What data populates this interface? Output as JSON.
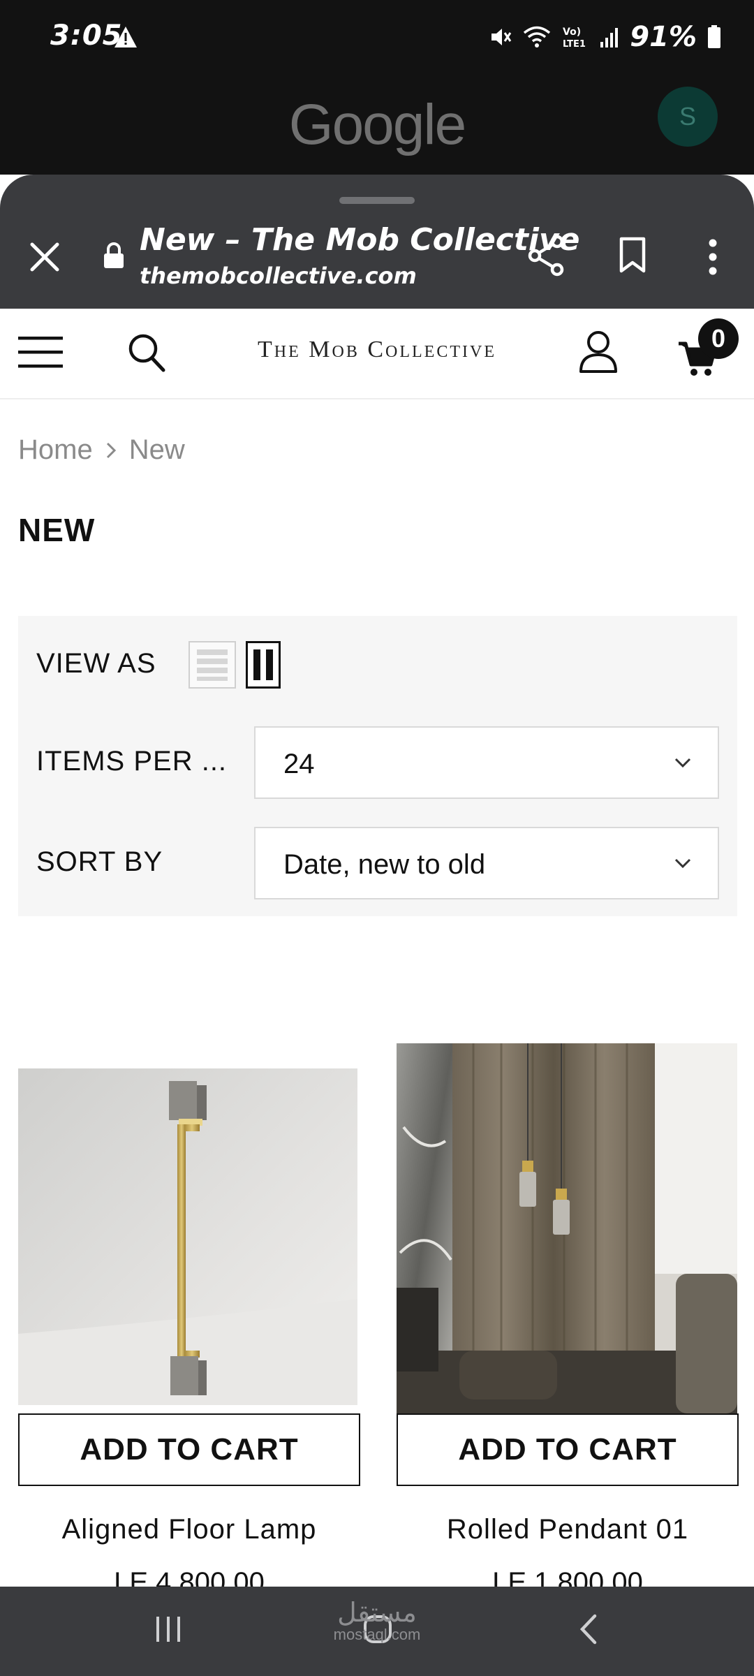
{
  "status_bar": {
    "time": "3:05",
    "battery": "91%",
    "network": "Vo) LTE1"
  },
  "google": {
    "logo": "Google",
    "avatar_letter": "S"
  },
  "custom_tab": {
    "title": "New – The Mob Collective",
    "url": "themobcollective.com"
  },
  "header": {
    "brand": "The Mob Collective",
    "cart_count": "0"
  },
  "breadcrumb": {
    "home": "Home",
    "current": "New"
  },
  "page": {
    "title": "NEW"
  },
  "toolbar": {
    "view_as_label": "VIEW AS",
    "items_per_label": "ITEMS PER ...",
    "items_per_value": "24",
    "sort_by_label": "SORT BY",
    "sort_by_value": "Date, new to old"
  },
  "products": [
    {
      "name": "Aligned Floor Lamp",
      "price": "LE 4,800.00",
      "button": "ADD TO CART"
    },
    {
      "name": "Rolled Pendant 01",
      "price": "LE 1,800.00",
      "button": "ADD TO CART"
    }
  ],
  "watermark": {
    "arabic": "مستقل",
    "latin": "mostaql.com"
  },
  "colors": {
    "status_bg": "#121212",
    "tab_bg": "#3a3b3e",
    "toolbar_bg": "#f6f6f6",
    "text": "#111111",
    "muted": "#8a8a8a"
  }
}
